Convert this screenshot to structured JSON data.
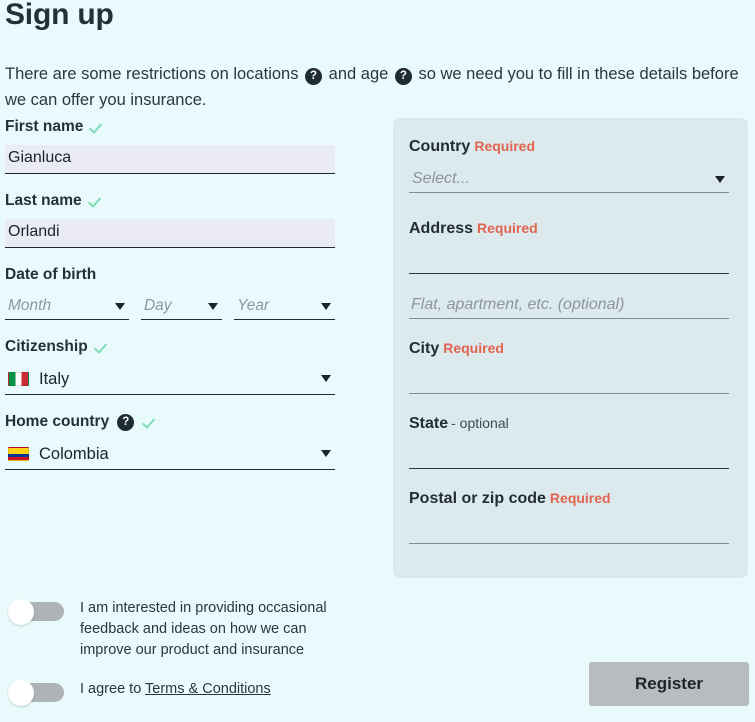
{
  "header": {
    "title": "Sign up",
    "intro_part1": "There are some restrictions on locations",
    "intro_part2": "and age",
    "intro_part3": "so we need you to fill in these details before we can offer you insurance.",
    "help_glyph": "?"
  },
  "personal": {
    "first_name": {
      "label": "First name",
      "value": "Gianluca",
      "valid": true
    },
    "last_name": {
      "label": "Last name",
      "value": "Orlandi",
      "valid": true
    },
    "date_of_birth": {
      "label": "Date of birth",
      "month_placeholder": "Month",
      "day_placeholder": "Day",
      "year_placeholder": "Year"
    },
    "citizenship": {
      "label": "Citizenship",
      "value": "Italy",
      "flag": "italy-flag-icon",
      "valid": true
    },
    "home_country": {
      "label": "Home country",
      "value": "Colombia",
      "flag": "colombia-flag-icon",
      "valid": true,
      "help_glyph": "?"
    }
  },
  "address_panel": {
    "country": {
      "label": "Country",
      "required_text": "Required",
      "placeholder": "Select..."
    },
    "address": {
      "label": "Address",
      "required_text": "Required",
      "value": "",
      "line2_placeholder": "Flat, apartment, etc. (optional)"
    },
    "city": {
      "label": "City",
      "required_text": "Required",
      "value": ""
    },
    "state": {
      "label": "State",
      "optional_text": "- optional",
      "value": ""
    },
    "postal": {
      "label": "Postal or zip code",
      "required_text": "Required",
      "value": ""
    }
  },
  "consents": [
    {
      "text": "I am interested in providing occasional feedback and ideas on how we can improve our product and insurance",
      "checked": false
    },
    {
      "text_prefix": "I agree to ",
      "link_text": "Terms & Conditions",
      "checked": false
    }
  ],
  "actions": {
    "register_label": "Register",
    "register_enabled": false
  },
  "colors": {
    "page_background": "#e8fafb",
    "panel_background": "#dceaed",
    "required_red": "#e2644f",
    "check_green": "#7fdcb4",
    "input_autofill": "#ebebf6",
    "button_disabled": "#b9bcbf",
    "text_primary": "#27323a",
    "placeholder": "#8d969c"
  }
}
